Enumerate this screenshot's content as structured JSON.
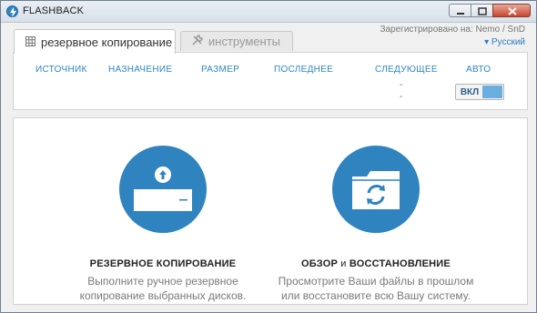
{
  "window": {
    "title": "FLASHBACK"
  },
  "tabs": [
    {
      "label": "резервное копирование",
      "icon": "grid-icon",
      "active": true
    },
    {
      "label": "инструменты",
      "icon": "tools-icon",
      "active": false
    }
  ],
  "header": {
    "registered": "Зарегистрировано на: Nemo / SnD",
    "language": "Русский"
  },
  "schedule": {
    "columns": [
      "ИСТОЧНИК",
      "НАЗНАЧЕНИЕ",
      "РАЗМЕР",
      "ПОСЛЕДНЕЕ",
      "СЛЕДУЮЩЕЕ",
      "АВТО"
    ],
    "next_values": [
      "-",
      "-"
    ],
    "auto_label": "ВКЛ"
  },
  "actions": {
    "backup": {
      "title": "РЕЗЕРВНОЕ КОПИРОВАНИЕ",
      "desc_line1": "Выполните ручное резервное",
      "desc_line2": "копирование выбранных дисков."
    },
    "restore": {
      "title_part1": "ОБЗОР",
      "title_part2": "и",
      "title_part3": "ВОССТАНОВЛЕНИЕ",
      "desc_line1": "Просмотрите Ваши файлы в прошлом",
      "desc_line2": "или восстановите всю Вашу систему."
    }
  },
  "colors": {
    "accent": "#2f84c0",
    "link": "#2e86c5"
  }
}
